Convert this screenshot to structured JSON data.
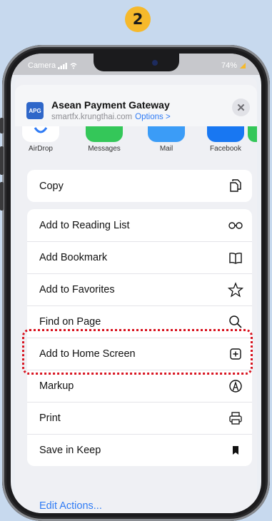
{
  "step_number": "2",
  "status_bar": {
    "carrier": "Camera",
    "battery": "74%"
  },
  "share_header": {
    "app_icon_text": "APG",
    "title": "Asean Payment Gateway",
    "url": "smartfx.krungthai.com",
    "options_label": "Options >",
    "close_icon": "close-icon"
  },
  "apps": [
    {
      "label": "AirDrop",
      "color": "#ffffff",
      "icon": "airdrop-icon"
    },
    {
      "label": "Messages",
      "color": "#34c759",
      "icon": "messages-icon"
    },
    {
      "label": "Mail",
      "color": "#3b9cf7",
      "icon": "mail-icon"
    },
    {
      "label": "Facebook",
      "color": "#1877f2",
      "icon": "facebook-icon"
    }
  ],
  "actions": {
    "copy": "Copy",
    "add_to_reading_list": "Add to Reading List",
    "add_bookmark": "Add Bookmark",
    "add_to_favorites": "Add to Favorites",
    "find_on_page": "Find on Page",
    "add_to_home_screen": "Add to Home Screen",
    "markup": "Markup",
    "print": "Print",
    "save_in_keep": "Save in Keep"
  },
  "edit_actions_label": "Edit Actions...",
  "colors": {
    "accent": "#2f7bf5",
    "highlight": "#d8131f",
    "badge": "#f6b92b"
  }
}
